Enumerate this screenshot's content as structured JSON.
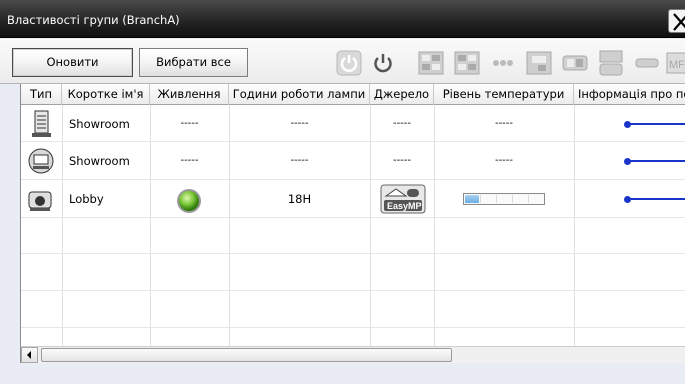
{
  "window": {
    "title": "Властивості групи (BranchA)"
  },
  "toolbar": {
    "refresh_label": "Оновити",
    "select_all_label": "Вибрати все",
    "icons": [
      "power-on-disabled",
      "power-off",
      "source-computer",
      "source-video",
      "source-network",
      "source-usb",
      "source-ab",
      "source-cycle",
      "source-hdmi",
      "source-mb"
    ],
    "truncated_label": "MF"
  },
  "table": {
    "columns": [
      "Тип",
      "Коротке ім'я",
      "Живлення",
      "Години роботи лампи",
      "Джерело",
      "Рівень температури",
      "Інформація про по"
    ],
    "rows": [
      {
        "type_icon": "tower-projector-icon",
        "name": "Showroom",
        "power": "-----",
        "lamp": "-----",
        "source": "-----",
        "temp": "-----",
        "info": ""
      },
      {
        "type_icon": "projector-rounded-icon",
        "name": "Showroom",
        "power": "-----",
        "lamp": "-----",
        "source": "-----",
        "temp": "-----",
        "info": ""
      },
      {
        "type_icon": "projector-small-icon",
        "name": "Lobby",
        "power": "power-on-green",
        "lamp": "18H",
        "source": "EasyMP",
        "temp_level": 0.18,
        "info": ""
      }
    ]
  },
  "colors": {
    "accent_blue": "#1a35c9",
    "power_green": "#4fa814",
    "temp_fill": "#7ab8e8"
  }
}
